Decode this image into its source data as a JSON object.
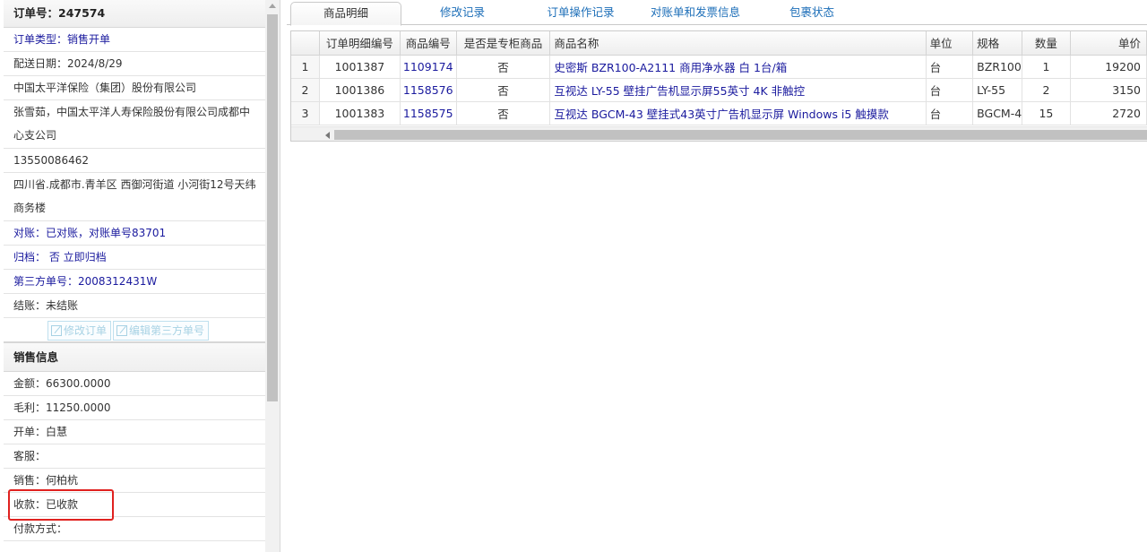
{
  "order": {
    "header": "订单号：247574",
    "rows": [
      {
        "text": "订单类型：销售开单",
        "blue": true
      },
      {
        "text": "配送日期：2024/8/29",
        "blue": false
      },
      {
        "text": "中国太平洋保险（集团）股份有限公司",
        "blue": false
      },
      {
        "text": "张雪茹，中国太平洋人寿保险股份有限公司成都中心支公司",
        "blue": false,
        "tall": true
      },
      {
        "text": "13550086462",
        "blue": false
      },
      {
        "text": "四川省.成都市.青羊区 西御河街道 小河街12号天纬商务楼",
        "blue": false,
        "tall": true
      },
      {
        "text": "对账：已对账，对账单号83701",
        "blue": true
      },
      {
        "text": "归档： 否 立即归档",
        "blue": true
      },
      {
        "text": "第三方单号：2008312431W",
        "blue": true
      },
      {
        "text": "结账：未结账",
        "blue": false
      }
    ],
    "buttons": {
      "edit_order": "修改订单",
      "edit_third_party": "编辑第三方单号"
    }
  },
  "sales": {
    "header": "销售信息",
    "amount": "金额：66300.0000",
    "gross_profit": "毛利：11250.0000",
    "biller": "开单：白慧",
    "service": "客服：",
    "salesperson": "销售：何柏杭",
    "payment_received": "收款：已收款",
    "payment_method": "付款方式："
  },
  "tabs": [
    "商品明细",
    "修改记录",
    "订单操作记录",
    "对账单和发票信息",
    "包裹状态"
  ],
  "table": {
    "columns": [
      "",
      "订单明细编号",
      "商品编号",
      "是否是专柜商品",
      "商品名称",
      "单位",
      "规格",
      "数量",
      "单价"
    ],
    "rows": [
      {
        "idx": "1",
        "detail_no": "1001387",
        "product_no": "1109174",
        "counter": "否",
        "name": "史密斯 BZR100-A2111 商用净水器 白 1台/箱",
        "unit": "台",
        "spec": "BZR100",
        "qty": "1",
        "price": "19200"
      },
      {
        "idx": "2",
        "detail_no": "1001386",
        "product_no": "1158576",
        "counter": "否",
        "name": "互视达 LY-55 壁挂广告机显示屏55英寸 4K 非触控",
        "unit": "台",
        "spec": "LY-55",
        "qty": "2",
        "price": "3150"
      },
      {
        "idx": "3",
        "detail_no": "1001383",
        "product_no": "1158575",
        "counter": "否",
        "name": "互视达 BGCM-43 壁挂式43英寸广告机显示屏 Windows i5 触摸款",
        "unit": "台",
        "spec": "BGCM-4",
        "qty": "15",
        "price": "2720"
      }
    ]
  },
  "colors": {
    "link": "#1a1a9e",
    "tab_link": "#1c6eb8",
    "highlight": "#e0211f"
  }
}
